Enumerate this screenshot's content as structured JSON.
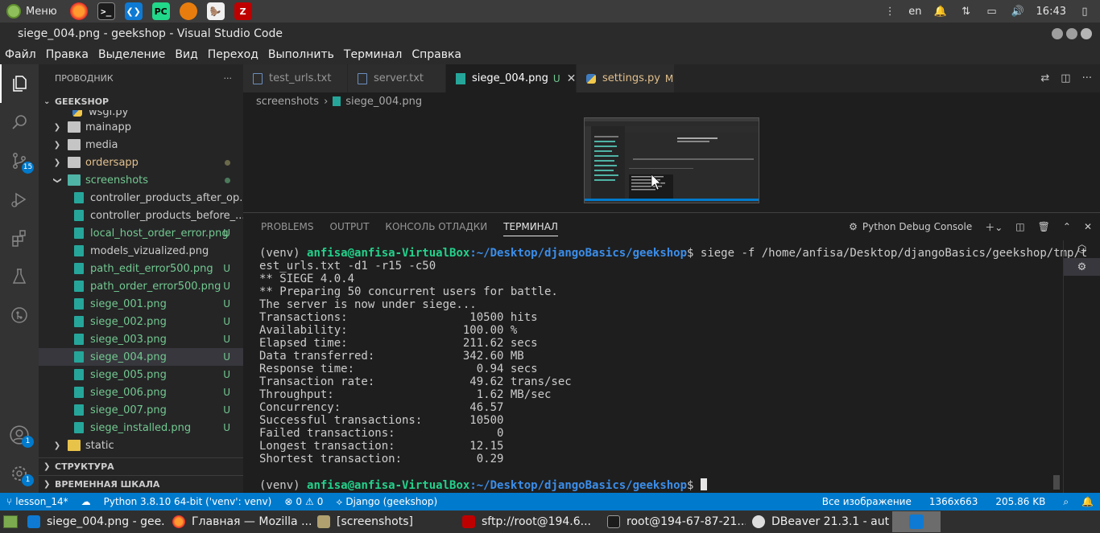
{
  "system_panel": {
    "menu_label": "Меню",
    "keyboard_layout": "en",
    "clock": "16:43"
  },
  "window": {
    "title": "siege_004.png - geekshop - Visual Studio Code"
  },
  "menubar": [
    "Файл",
    "Правка",
    "Выделение",
    "Вид",
    "Переход",
    "Выполнить",
    "Терминал",
    "Справка"
  ],
  "activity": {
    "scm_badge": "15",
    "accounts_badge": "1",
    "settings_badge": "1"
  },
  "sidebar": {
    "title": "ПРОВОДНИК",
    "more": "···",
    "project": "GEEKSHOP",
    "items": [
      {
        "label": "wsgi.py"
      },
      {
        "label": "mainapp"
      },
      {
        "label": "media"
      },
      {
        "label": "ordersapp"
      },
      {
        "label": "screenshots"
      },
      {
        "label": "controller_products_after_op..."
      },
      {
        "label": "controller_products_before_..."
      },
      {
        "label": "local_host_order_error.png",
        "status": "U"
      },
      {
        "label": "models_vizualized.png"
      },
      {
        "label": "path_edit_error500.png",
        "status": "U"
      },
      {
        "label": "path_order_error500.png",
        "status": "U"
      },
      {
        "label": "siege_001.png",
        "status": "U"
      },
      {
        "label": "siege_002.png",
        "status": "U"
      },
      {
        "label": "siege_003.png",
        "status": "U"
      },
      {
        "label": "siege_004.png",
        "status": "U"
      },
      {
        "label": "siege_005.png",
        "status": "U"
      },
      {
        "label": "siege_006.png",
        "status": "U"
      },
      {
        "label": "siege_007.png",
        "status": "U"
      },
      {
        "label": "siege_installed.png",
        "status": "U"
      },
      {
        "label": "static"
      }
    ],
    "outline": "СТРУКТУРА",
    "timeline": "ВРЕМЕННАЯ ШКАЛА"
  },
  "tabs": [
    {
      "label": "test_urls.txt"
    },
    {
      "label": "server.txt"
    },
    {
      "label": "siege_004.png",
      "mark": "U"
    },
    {
      "label": "settings.py",
      "mark": "M"
    }
  ],
  "breadcrumb": {
    "folder": "screenshots",
    "file": "siege_004.png"
  },
  "panel": {
    "tabs": [
      "PROBLEMS",
      "OUTPUT",
      "КОНСОЛЬ ОТЛАДКИ",
      "ТЕРМИНАЛ"
    ],
    "debug_console": "Python Debug Console"
  },
  "terminal": {
    "venv": "(venv) ",
    "user": "anfisa@anfisa-VirtualBox",
    "path": ":~/Desktop/djangoBasics/geekshop",
    "command_line1": "$ siege -f /home/anfisa/Desktop/djangoBasics/geekshop/tmp/t",
    "command_line2": "est_urls.txt -d1 -r15 -c50",
    "output": [
      "** SIEGE 4.0.4",
      "** Preparing 50 concurrent users for battle.",
      "The server is now under siege...",
      "Transactions:                  10500 hits",
      "Availability:                 100.00 %",
      "Elapsed time:                 211.62 secs",
      "Data transferred:             342.60 MB",
      "Response time:                  0.94 secs",
      "Transaction rate:              49.62 trans/sec",
      "Throughput:                     1.62 MB/sec",
      "Concurrency:                   46.57",
      "Successful transactions:       10500",
      "Failed transactions:               0",
      "Longest transaction:           12.15",
      "Shortest transaction:           0.29"
    ],
    "prompt_end": "$ "
  },
  "status": {
    "branch": "lesson_14*",
    "python": "Python 3.8.10 64-bit ('venv': venv)",
    "errors": "0",
    "warnings": "0",
    "django": "Django (geekshop)",
    "image_view": "Все изображение",
    "dimensions": "1366x663",
    "size": "205.86 KB"
  },
  "taskbar": [
    {
      "label": "siege_004.png - gee..."
    },
    {
      "label": "Главная — Mozilla ..."
    },
    {
      "label": "[screenshots]"
    },
    {
      "label": "sftp://root@194.6..."
    },
    {
      "label": "root@194-67-87-21..."
    },
    {
      "label": "DBeaver 21.3.1 - aut..."
    }
  ]
}
